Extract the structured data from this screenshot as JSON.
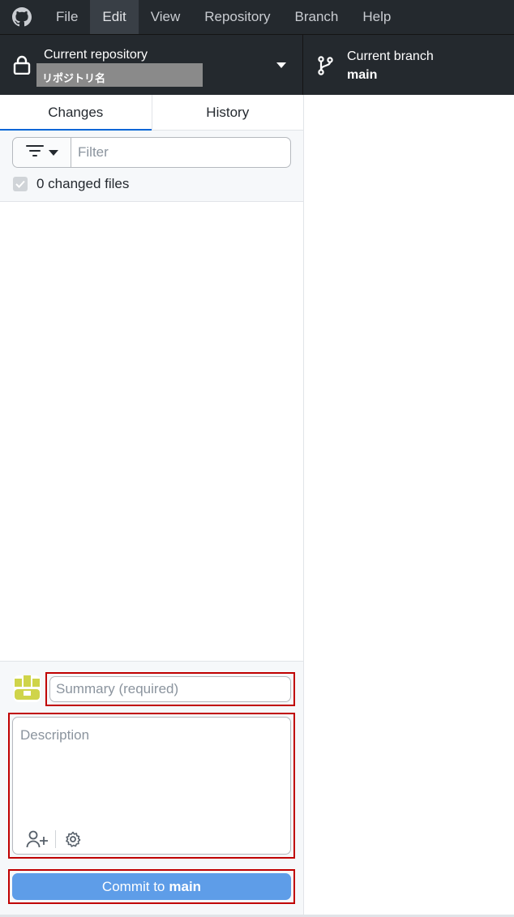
{
  "menu": {
    "items": [
      {
        "label": "File"
      },
      {
        "label": "Edit"
      },
      {
        "label": "View"
      },
      {
        "label": "Repository"
      },
      {
        "label": "Branch"
      },
      {
        "label": "Help"
      }
    ],
    "active_index": 1
  },
  "toolbar": {
    "repo_label": "Current repository",
    "repo_name": "リポジトリ名",
    "branch_label": "Current branch",
    "branch_name": "main"
  },
  "tabs": [
    {
      "label": "Changes",
      "active": true
    },
    {
      "label": "History",
      "active": false
    }
  ],
  "filter": {
    "placeholder": "Filter",
    "changed_files": "0 changed files"
  },
  "commit": {
    "summary_placeholder": "Summary (required)",
    "description_placeholder": "Description",
    "button_prefix": "Commit to",
    "button_branch": "main"
  },
  "colors": {
    "toolbar_bg": "#24292e",
    "accent": "#0366d6",
    "commit_button": "#5e9de8",
    "highlight": "#c00000"
  },
  "icons": [
    "github-logo-icon",
    "lock-icon",
    "chevron-down-icon",
    "git-branch-icon",
    "filter-icon",
    "checkbox-icon",
    "avatar",
    "add-coauthor-icon",
    "gear-icon"
  ]
}
